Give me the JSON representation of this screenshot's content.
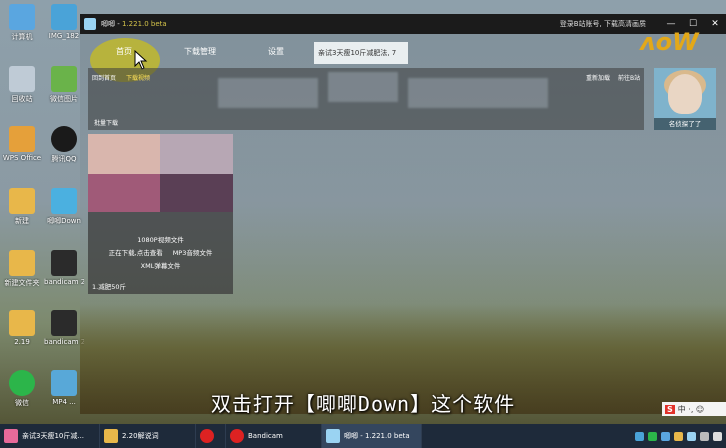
{
  "desktop": {
    "icons": [
      {
        "label": "计算机",
        "color": "#5aa6e0"
      },
      {
        "label": "IMG_182",
        "color": "#4aa3d8"
      },
      {
        "label": "回收站",
        "color": "#bfcbd6"
      },
      {
        "label": "微信图片",
        "color": "#6ab34a"
      },
      {
        "label": "WPS Office",
        "color": "#e5a03a"
      },
      {
        "label": "腾讯QQ",
        "color": "#1a1a1a"
      },
      {
        "label": "新建",
        "color": "#e8b74a"
      },
      {
        "label": "唧唧Down",
        "color": "#4bb0e0"
      },
      {
        "label": "新建文件夹",
        "color": "#e8b74a"
      },
      {
        "label": "bandicam 2020-02-2...",
        "color": "#2b2b2b"
      },
      {
        "label": "2.19",
        "color": "#e8b74a"
      },
      {
        "label": "bandicam 2020-02-2...",
        "color": "#2b2b2b"
      },
      {
        "label": "微信",
        "color": "#2cb54a"
      },
      {
        "label": "MP4 ...",
        "color": "#58a8d8"
      }
    ]
  },
  "app": {
    "title": "唧唧 - ",
    "version": "1.221.0 beta",
    "login_text": "登录B站账号, 下载高清画质",
    "window_controls": {
      "minimize": "—",
      "maximize": "☐",
      "close": "✕"
    },
    "nav": {
      "home": "首页",
      "download_manager": "下载管理",
      "settings": "设置",
      "search_value": "亲试3天瘦10斤减肥法, 7"
    },
    "content_links": {
      "back_home": "回到首页",
      "download_video": "下载视频",
      "reload": "重新加载",
      "goto_bilibili": "前往B站"
    },
    "section_title": "批量下载",
    "card": {
      "options": {
        "video": "1080P视频文件",
        "downloading": "正在下载,点击查看",
        "mp3": "MP3音频文件",
        "xml": "XML弹幕文件"
      },
      "name": "1.减肥50斤",
      "thumb_colors": [
        "#d9b6ad",
        "#b7a7b4",
        "#a05a78",
        "#5a3f55"
      ]
    },
    "avatar_label": "名侦探了了",
    "corner_logo": "ʌoW"
  },
  "subtitle": "双击打开【唧唧Down】这个软件",
  "ime": {
    "logo": "S",
    "text": "中 ·, ☺"
  },
  "taskbar": {
    "items": [
      {
        "label": "亲试3天瘦10斤减...",
        "color": "#e86a9a"
      },
      {
        "label": "2.20解说词",
        "color": "#e8b74a"
      },
      {
        "label": "",
        "color": "#d22"
      },
      {
        "label": "Bandicam",
        "color": "#d22"
      },
      {
        "label": "唧唧 - 1.221.0 beta",
        "color": "#9ad3f2"
      }
    ]
  }
}
